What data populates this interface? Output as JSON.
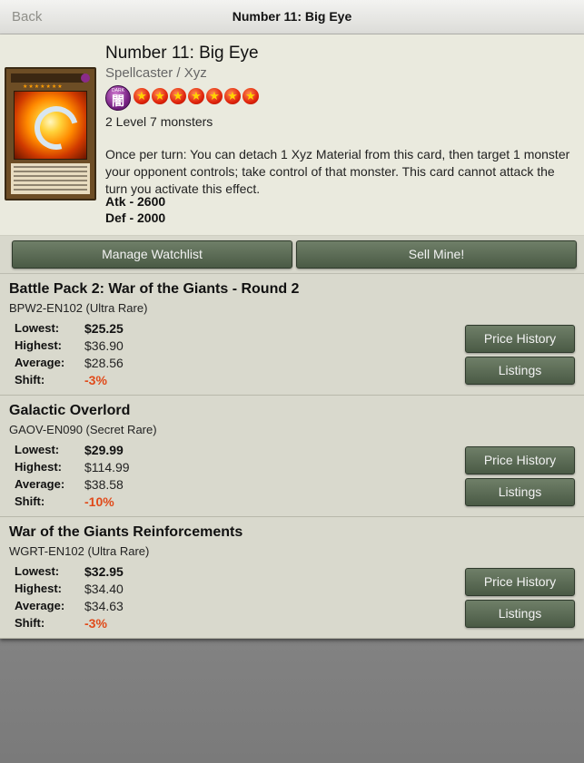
{
  "nav": {
    "back_label": "Back",
    "title": "Number 11: Big Eye"
  },
  "card": {
    "name": "Number 11: Big Eye",
    "type": "Spellcaster / Xyz",
    "attribute_top": "DARK",
    "attribute_kanji": "闇",
    "rank_stars": 7,
    "materials": "2 Level 7 monsters",
    "effect": "Once per turn: You can detach 1 Xyz Material from this card, then target 1 monster your opponent controls; take control of that monster. This card cannot attack the turn you activate this effect.",
    "atk": "Atk - 2600",
    "def": "Def - 2000"
  },
  "actions": {
    "watchlist_label": "Manage Watchlist",
    "sell_label": "Sell Mine!"
  },
  "labels": {
    "lowest": "Lowest:",
    "highest": "Highest:",
    "average": "Average:",
    "shift": "Shift:",
    "price_history": "Price History",
    "listings": "Listings"
  },
  "sets": [
    {
      "name": "Battle Pack 2: War of the Giants - Round 2",
      "code": "BPW2-EN102 (Ultra Rare)",
      "lowest": "$25.25",
      "highest": "$36.90",
      "average": "$28.56",
      "shift": "-3%"
    },
    {
      "name": "Galactic Overlord",
      "code": "GAOV-EN090 (Secret Rare)",
      "lowest": "$29.99",
      "highest": "$114.99",
      "average": "$38.58",
      "shift": "-10%"
    },
    {
      "name": "War of the Giants Reinforcements",
      "code": "WGRT-EN102 (Ultra Rare)",
      "lowest": "$32.95",
      "highest": "$34.40",
      "average": "$34.63",
      "shift": "-3%"
    }
  ],
  "colors": {
    "shift_negative": "#e04a1a",
    "button": "#5a6a54",
    "star": "#e0240c"
  }
}
